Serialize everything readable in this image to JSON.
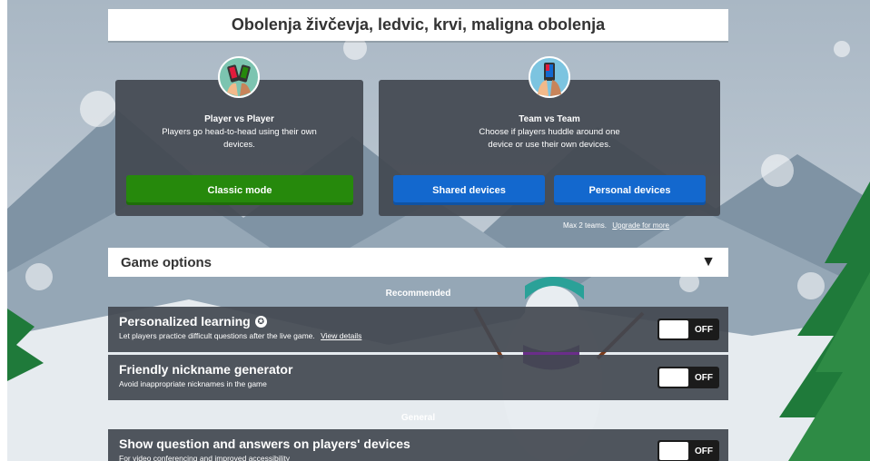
{
  "header": {
    "title": "Obolenja živčevja, ledvic, krvi, maligna obolenja"
  },
  "modes": {
    "pvp": {
      "title": "Player vs Player",
      "description": "Players go head-to-head using their own devices.",
      "button": "Classic mode"
    },
    "tvt": {
      "title": "Team vs Team",
      "description": "Choose if players huddle around one device or use their own devices.",
      "button_shared": "Shared devices",
      "button_personal": "Personal devices"
    },
    "max_teams": "Max 2 teams.",
    "upgrade_link": "Upgrade for more"
  },
  "options": {
    "label": "Game options",
    "arrow": "▼",
    "recommended_header": "Recommended",
    "general_header": "General",
    "rows": [
      {
        "title": "Personalized learning",
        "badge": "✪",
        "description": "Let players practice difficult questions after the live game.",
        "link": "View details",
        "state": "OFF"
      },
      {
        "title": "Friendly nickname generator",
        "description": "Avoid inappropriate nicknames in the game",
        "state": "OFF"
      },
      {
        "title": "Show question and answers on players' devices",
        "description": "For video conferencing and improved accessibility",
        "state": "OFF"
      }
    ]
  },
  "colors": {
    "green": "#26890c",
    "blue": "#1368ce",
    "panel": "#424850"
  }
}
